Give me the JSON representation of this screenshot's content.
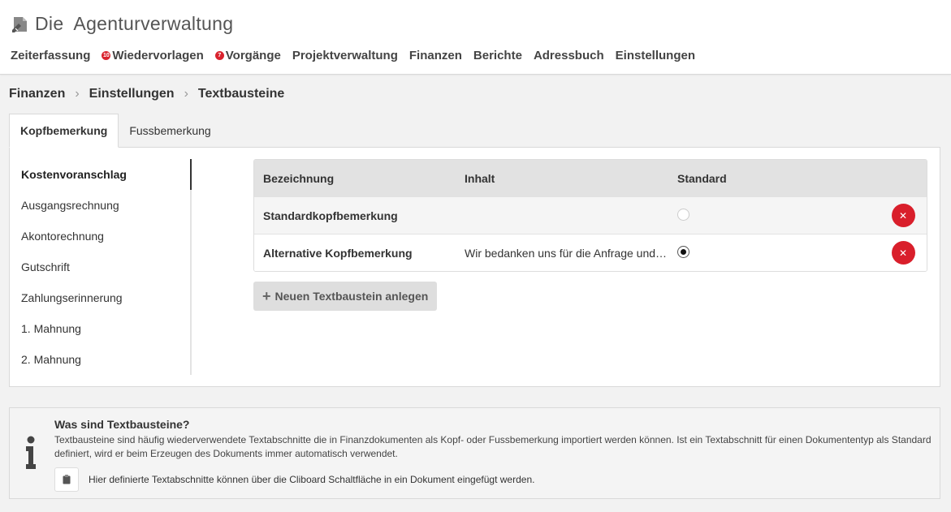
{
  "app": {
    "logo_icon": "pencil-doc-icon",
    "title_prefix": "Die",
    "title_main": "Agenturverwaltung"
  },
  "nav": {
    "items": [
      {
        "label": "Zeiterfassung"
      },
      {
        "label": "Wiedervorlagen",
        "badge": "10"
      },
      {
        "label": "Vorgänge",
        "badge": "7"
      },
      {
        "label": "Projektverwaltung"
      },
      {
        "label": "Finanzen"
      },
      {
        "label": "Berichte"
      },
      {
        "label": "Adressbuch"
      },
      {
        "label": "Einstellungen"
      }
    ]
  },
  "breadcrumb": [
    "Finanzen",
    "Einstellungen",
    "Textbausteine"
  ],
  "tabs": [
    {
      "label": "Kopfbemerkung",
      "active": true
    },
    {
      "label": "Fussbemerkung",
      "active": false
    }
  ],
  "sidebar": {
    "items": [
      {
        "label": "Kostenvoranschlag",
        "active": true
      },
      {
        "label": "Ausgangsrechnung"
      },
      {
        "label": "Akontorechnung"
      },
      {
        "label": "Gutschrift"
      },
      {
        "label": "Zahlungserinnerung"
      },
      {
        "label": "1. Mahnung"
      },
      {
        "label": "2. Mahnung"
      }
    ]
  },
  "table": {
    "headers": [
      "Bezeichnung",
      "Inhalt",
      "Standard"
    ],
    "rows": [
      {
        "name": "Standardkopfbemerkung",
        "content": "",
        "standard": false
      },
      {
        "name": "Alternative Kopfbemerkung",
        "content": "Wir bedanken uns für die Anfrage und…",
        "standard": true
      }
    ]
  },
  "add_button": {
    "label": "Neuen Textbaustein anlegen"
  },
  "info": {
    "title": "Was sind Textbausteine?",
    "text": "Textbausteine sind häufig wiederverwendete Textabschnitte die in Finanzdokumenten als Kopf- oder Fussbemerkung importiert werden können. Ist ein Textabschnitt für einen Dokumententyp als Standard definiert, wird er beim Erzeugen des Dokuments immer automatisch verwendet.",
    "clipboard_text": "Hier definierte Textabschnitte können über die Cliboard Schaltfläche in ein Dokument eingefügt werden."
  },
  "colors": {
    "accent_red": "#d91f2b",
    "header_bg": "#e2e2e2"
  }
}
